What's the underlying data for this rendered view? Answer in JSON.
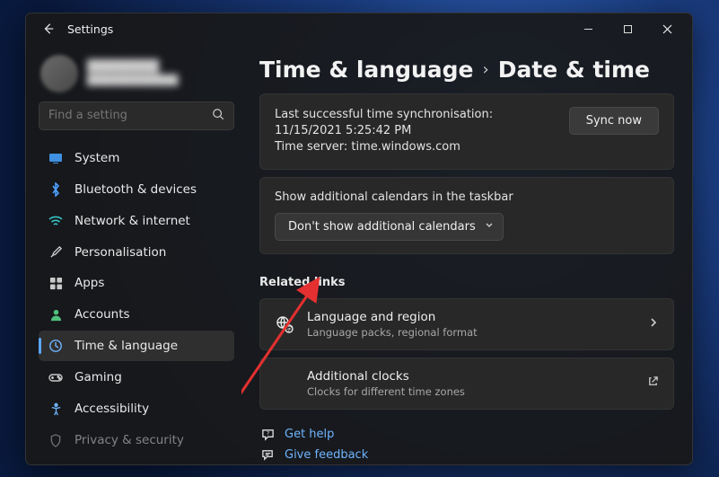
{
  "window": {
    "title": "Settings"
  },
  "sidebar": {
    "search_placeholder": "Find a setting",
    "items": [
      {
        "label": "System"
      },
      {
        "label": "Bluetooth & devices"
      },
      {
        "label": "Network & internet"
      },
      {
        "label": "Personalisation"
      },
      {
        "label": "Apps"
      },
      {
        "label": "Accounts"
      },
      {
        "label": "Time & language"
      },
      {
        "label": "Gaming"
      },
      {
        "label": "Accessibility"
      },
      {
        "label": "Privacy & security"
      }
    ]
  },
  "breadcrumb": {
    "parent": "Time & language",
    "current": "Date & time"
  },
  "sync": {
    "line1": "Last successful time synchronisation: 11/15/2021 5:25:42 PM",
    "line2": "Time server: time.windows.com",
    "button": "Sync now"
  },
  "calendar_card": {
    "title": "Show additional calendars in the taskbar",
    "selected": "Don't show additional calendars"
  },
  "related": {
    "heading": "Related links",
    "language": {
      "title": "Language and region",
      "sub": "Language packs, regional format"
    },
    "clocks": {
      "title": "Additional clocks",
      "sub": "Clocks for different time zones"
    }
  },
  "footer": {
    "help": "Get help",
    "feedback": "Give feedback"
  }
}
